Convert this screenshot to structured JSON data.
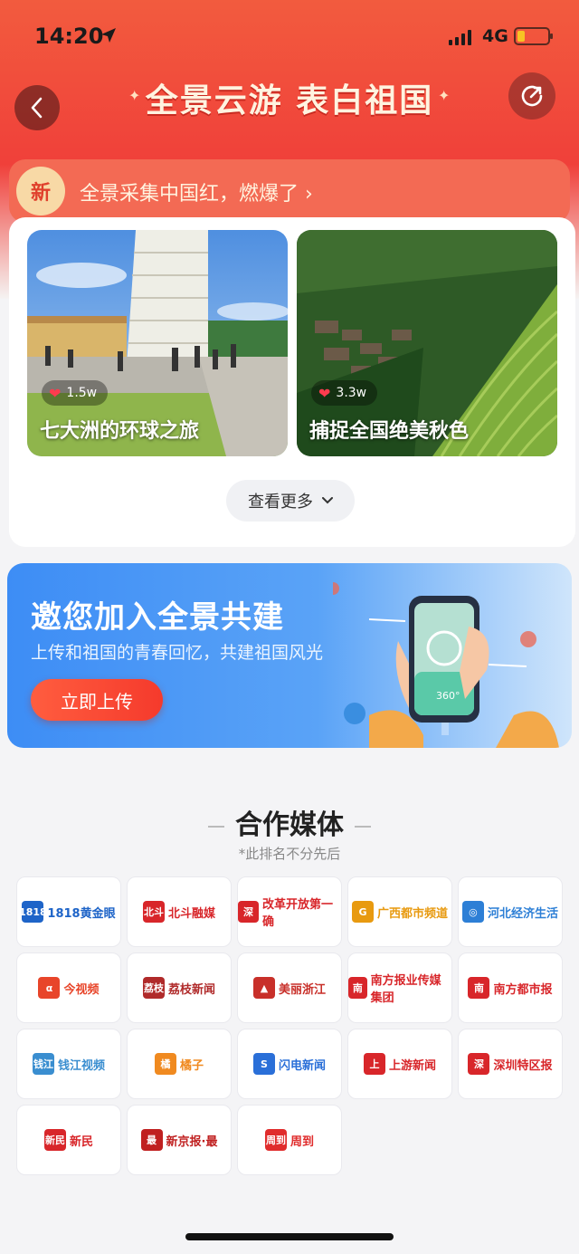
{
  "status_bar": {
    "time": "14:20",
    "network": "4G",
    "battery_level": 0.25
  },
  "header": {
    "title": "全景云游 表白祖国"
  },
  "notice": {
    "badge": "新",
    "text": "全景采集中国红，燃爆了 ›"
  },
  "cards": [
    {
      "likes": "1.5w",
      "caption": "七大洲的环球之旅"
    },
    {
      "likes": "3.3w",
      "caption": "捕捉全国绝美秋色"
    }
  ],
  "more_button": {
    "label": "查看更多"
  },
  "banner": {
    "title": "邀您加入全景共建",
    "subtitle": "上传和祖国的青春回忆，共建祖国风光",
    "button": "立即上传",
    "phone_label": "360°"
  },
  "partners": {
    "title": "合作媒体",
    "note": "*此排名不分先后",
    "items": [
      {
        "name": "1818黄金眼",
        "color": "#1e64c8",
        "mark": "1818"
      },
      {
        "name": "北斗融媒",
        "color": "#d8262a",
        "mark": "北斗"
      },
      {
        "name": "改革开放第一确",
        "color": "#d8262a",
        "mark": "深"
      },
      {
        "name": "广西都市频道",
        "color": "#e89a10",
        "mark": "G"
      },
      {
        "name": "河北经济生活",
        "color": "#2d7fd6",
        "mark": "◎"
      },
      {
        "name": "今视频",
        "color": "#e8452a",
        "mark": "α"
      },
      {
        "name": "荔枝新闻",
        "color": "#b02a2a",
        "mark": "荔枝"
      },
      {
        "name": "美丽浙江",
        "color": "#c8302a",
        "mark": "▲"
      },
      {
        "name": "南方报业传媒集团",
        "color": "#d8262a",
        "mark": "南"
      },
      {
        "name": "南方都市报",
        "color": "#d8262a",
        "mark": "南"
      },
      {
        "name": "钱江视频",
        "color": "#3a8ed0",
        "mark": "钱江"
      },
      {
        "name": "橘子",
        "color": "#f08a20",
        "mark": "橘"
      },
      {
        "name": "闪电新闻",
        "color": "#2a6fd8",
        "mark": "S"
      },
      {
        "name": "上游新闻",
        "color": "#d8262a",
        "mark": "上"
      },
      {
        "name": "深圳特区报",
        "color": "#d8262a",
        "mark": "深"
      },
      {
        "name": "新民",
        "color": "#d8262a",
        "mark": "新民"
      },
      {
        "name": "新京报·最",
        "color": "#c02020",
        "mark": "最"
      },
      {
        "name": "周到",
        "color": "#e02c2c",
        "mark": "周到"
      }
    ]
  },
  "colors": {
    "header_red": "#f0403a",
    "accent_blue": "#3d8df5",
    "cta_red": "#f53a2c"
  }
}
